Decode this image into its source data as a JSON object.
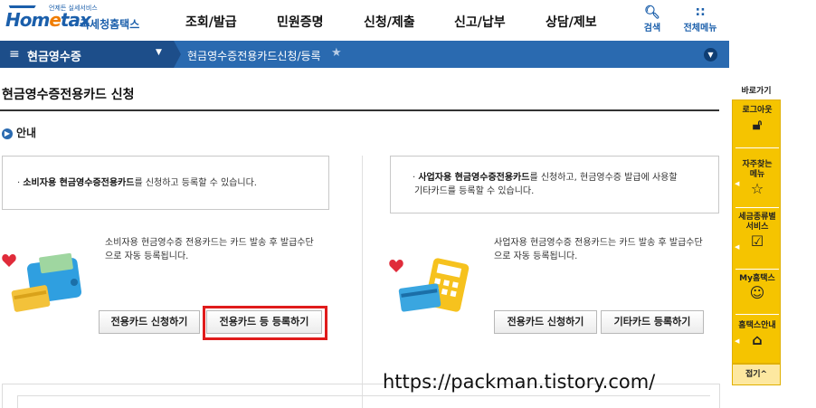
{
  "header": {
    "logo_tagline": "언제든 실세서비스",
    "logo_mark_a": "Hom",
    "logo_mark_e": "e",
    "logo_mark_b": "tax",
    "logo_kor": "국세청홈택스",
    "nav": [
      "조회/발급",
      "민원증명",
      "신청/제출",
      "신고/납부",
      "상담/제보"
    ],
    "search_label": "검색",
    "allmenu_label": "전체메뉴"
  },
  "navbar": {
    "menu_title": "현금영수증",
    "breadcrumb": "현금영수증전용카드신청/등록"
  },
  "page": {
    "title": "현금영수증전용카드 신청",
    "section": "안내"
  },
  "left": {
    "info_prefix": "· ",
    "info_bold": "소비자용 현금영수증전용카드",
    "info_rest": "를 신청하고 등록할 수 있습니다.",
    "desc_line1": "소비자용 현금영수증 전용카드는 카드 발송 후 발급수단",
    "desc_line2": "으로 자동 등록됩니다.",
    "btn_apply": "전용카드 신청하기",
    "btn_register": "전용카드 등 등록하기"
  },
  "right": {
    "info_prefix": "· ",
    "info_bold": "사업자용 현금영수증전용카드",
    "info_rest1": "를 신청하고, 현금영수증 발급에 사용할",
    "info_rest2": "기타카드를 등록할 수 있습니다.",
    "desc_line1": "사업자용 현금영수증 전용카드는 카드 발송 후 발급수단",
    "desc_line2": "으로 자동 등록됩니다.",
    "btn_apply": "전용카드 신청하기",
    "btn_other": "기타카드 등록하기"
  },
  "quick": {
    "title": "바로가기",
    "items": [
      {
        "label1": "로그아웃",
        "label2": ""
      },
      {
        "label1": "자주찾는",
        "label2": "메뉴"
      },
      {
        "label1": "세금종류별",
        "label2": "서비스"
      },
      {
        "label1": "My홈택스",
        "label2": ""
      },
      {
        "label1": "홈택스안내",
        "label2": ""
      }
    ],
    "fold": "접기^"
  },
  "watermark": "https://packman.tistory.com/",
  "colors": {
    "brand_blue": "#1b5fab",
    "nav_blue": "#2a6ab0",
    "quick_yellow": "#f5c400",
    "highlight_red": "#e01b1b"
  }
}
